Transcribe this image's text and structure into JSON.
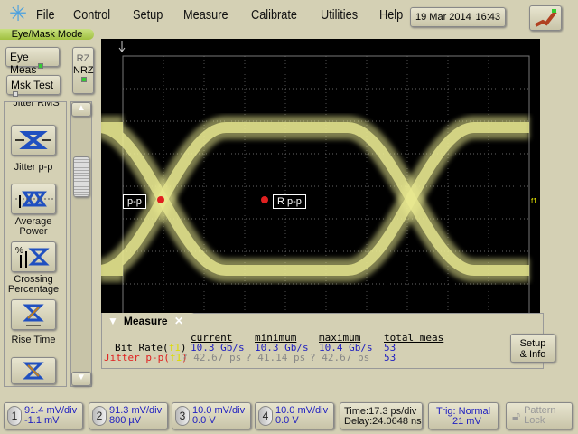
{
  "menu": [
    "File",
    "Control",
    "Setup",
    "Measure",
    "Calibrate",
    "Utilities",
    "Help"
  ],
  "datetime": {
    "date": "19 Mar 2014",
    "time": "16:43"
  },
  "mode_label": "Eye/Mask Mode",
  "buttons": {
    "eye_meas": "Eye Meas",
    "msk_test": "Msk Test",
    "rz": "RZ",
    "nrz": "NRZ",
    "setup_info_1": "Setup",
    "setup_info_2": "& Info",
    "pattern_lock_1": "Pattern",
    "pattern_lock_2": "Lock"
  },
  "sidebar": {
    "partial_item": "Jitter RMS",
    "items": [
      {
        "label": "Jitter p-p",
        "icon": "jitter-icon"
      },
      {
        "label": "Average\nPower",
        "icon": "average-power-icon"
      },
      {
        "label": "Crossing\nPercentage",
        "icon": "crossing-percentage-icon"
      },
      {
        "label": "Rise Time",
        "icon": "rise-time-icon"
      },
      {
        "label": "",
        "icon": "fall-time-icon"
      }
    ]
  },
  "markers": {
    "left": "p-p",
    "right": "R p-p",
    "trigger": "f1"
  },
  "measure": {
    "title": "Measure",
    "headers": [
      "current",
      "minimum",
      "maximum",
      "total meas"
    ],
    "rows": [
      {
        "name": "Bit Rate(",
        "src": "f1",
        "close": ")",
        "current": "10.3 Gb/s",
        "minimum": "10.3 Gb/s",
        "maximum": "10.4 Gb/s",
        "total": "53"
      },
      {
        "name": "Jitter p-p(",
        "src": "f1",
        "close": ")",
        "current": "? 42.67 ps",
        "minimum": "? 41.14 ps",
        "maximum": "? 42.67 ps",
        "total": "53"
      }
    ]
  },
  "channels": [
    {
      "n": "1",
      "scale": "91.4 mV/div",
      "offset": "-1.1 mV"
    },
    {
      "n": "2",
      "scale": "91.3 mV/div",
      "offset": "800 µV"
    },
    {
      "n": "3",
      "scale": "10.0 mV/div",
      "offset": "0.0 V"
    },
    {
      "n": "4",
      "scale": "10.0 mV/div",
      "offset": "0.0 V"
    }
  ],
  "timebase": {
    "time": "Time:17.3 ps/div",
    "delay": "Delay:24.0648 ns"
  },
  "trigger": {
    "mode": "Trig: Normal",
    "level": "21 mV"
  },
  "colors": {
    "trace": "#e8e890",
    "screen": "#000000",
    "value": "#2020c0",
    "jitter": "#e02020"
  }
}
